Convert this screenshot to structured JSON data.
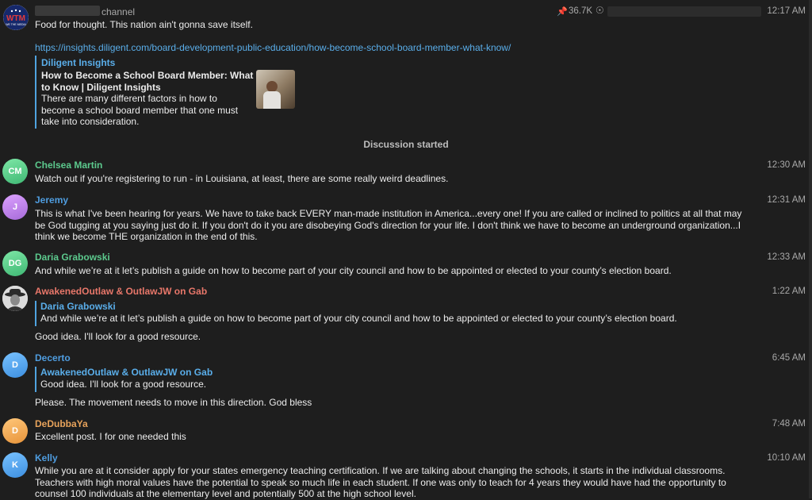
{
  "post": {
    "channel_label": "channel",
    "text": "Food for thought.  This nation ain't gonna save itself.",
    "link": "https://insights.diligent.com/board-development-public-education/how-become-school-board-member-what-know/",
    "pinned_count": "36.7K",
    "time": "12:17 AM",
    "preview": {
      "site": "Diligent Insights",
      "title": "How to Become a School Board Member: What to Know | Diligent Insights",
      "description": "There are many different factors in how to become a school board member that one must take into consideration."
    }
  },
  "logo_text": "WTM",
  "logo_subtext": "WE THE MEDIA",
  "discussion_label": "Discussion started",
  "comments": [
    {
      "name": "Chelsea Martin",
      "initials": "CM",
      "time": "12:30 AM",
      "color": "#5cc98d",
      "text": "Watch out if you're registering to run - in Louisiana, at least, there are some really weird deadlines."
    },
    {
      "name": "Jeremy",
      "initials": "J",
      "time": "12:31 AM",
      "color": "#9b7ad8",
      "text": "This is what I've been hearing for years. We have to take back EVERY man-made institution in America...every one! If you are called or inclined to politics at all that may be God tugging at you saying just do it. If you don't do it you are disobeying God's direction for your life. I don't think we have to become an underground organization...I think we become THE organization in the end of this."
    },
    {
      "name": "Daria Grabowski",
      "initials": "DG",
      "time": "12:33 AM",
      "color": "#5cc98d",
      "text": "And while we’re at it let’s publish a guide on how to become part of your city council and how to be appointed or elected to your county’s election board."
    },
    {
      "name": "AwakenedOutlaw & OutlawJW on Gab",
      "initials": "",
      "time": "1:22 AM",
      "color": "#e8776a",
      "reply_name": "Daria Grabowski",
      "reply_text": "And while we’re at it let’s publish a guide on how to become part of your city council and how to be appointed or elected to your county’s election board.",
      "text": "Good idea.  I'll look for a good resource."
    },
    {
      "name": "Decerto",
      "initials": "D",
      "time": "6:45 AM",
      "color": "#4f9de0",
      "reply_name": "AwakenedOutlaw & OutlawJW on Gab",
      "reply_text": "Good idea.  I'll look for a good resource.",
      "text": "Please. The movement needs to move in this direction. God bless"
    },
    {
      "name": "DeDubbaYa",
      "initials": "D",
      "time": "7:48 AM",
      "color": "#e8a35b",
      "text": "Excellent post. I for one needed this"
    },
    {
      "name": "Kelly",
      "initials": "K",
      "time": "10:10 AM",
      "color": "#4f9de0",
      "text": "While you are at it consider apply for your states emergency teaching certification. If we are talking about changing the schools, it starts in the individual classrooms. Teachers with high moral values have the potential to speak so much life in each student. If one was only to teach for 4 years they would have had the opportunity to counsel 100 individuals at the elementary level and potentially 500 at the high school level."
    }
  ]
}
